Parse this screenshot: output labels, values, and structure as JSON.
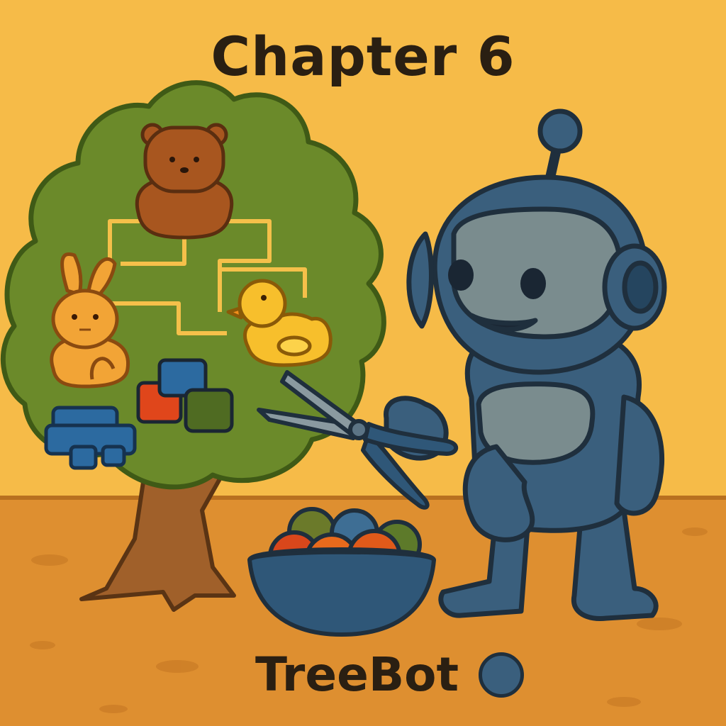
{
  "cover": {
    "title": "Chapter 6",
    "caption": "TreeBot"
  },
  "palette": {
    "background": "#f6bb48",
    "floor": "#de8f30",
    "foliage": "#6b8a2a",
    "trunk": "#a0602a",
    "robot_body": "#3a5f7d",
    "robot_face": "#7a8c8e",
    "outline": "#1f2f3d",
    "branch_lines": "#f5c04a"
  },
  "icons": {
    "tree": "tree-icon",
    "teddy": "teddy-bear-icon",
    "bunny": "bunny-icon",
    "duck": "duck-icon",
    "blocks": "toy-blocks-icon",
    "car": "toy-car-icon",
    "robot": "robot-icon",
    "scissors": "scissors-icon",
    "bowl": "bowl-icon"
  }
}
